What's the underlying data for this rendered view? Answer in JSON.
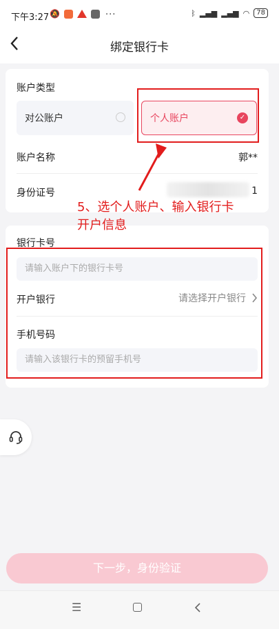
{
  "status_bar": {
    "time": "下午3:27",
    "battery": "78",
    "more": "···"
  },
  "header": {
    "title": "绑定银行卡",
    "back_icon": "chevron-left-icon"
  },
  "account_type": {
    "label": "账户类型",
    "options": [
      {
        "label": "对公账户",
        "selected": false
      },
      {
        "label": "个人账户",
        "selected": true
      }
    ]
  },
  "account_name": {
    "label": "账户名称",
    "value": "郭**"
  },
  "id_number": {
    "label": "身份证号",
    "value_suffix": "1"
  },
  "bank_form": {
    "card_label": "银行卡号",
    "card_placeholder": "请输入账户下的银行卡号",
    "bank_label": "开户银行",
    "bank_placeholder": "请选择开户银行",
    "phone_label": "手机号码",
    "phone_placeholder": "请输入该银行卡的预留手机号"
  },
  "annotation": {
    "line1": "5、选个人账户、输入银行卡",
    "line2": "开户信息"
  },
  "next_button": {
    "label": "下一步，身份验证"
  },
  "colors": {
    "accent": "#e8455e",
    "annotation_red": "#e21c1c",
    "button_bg": "#f9c9d2"
  }
}
